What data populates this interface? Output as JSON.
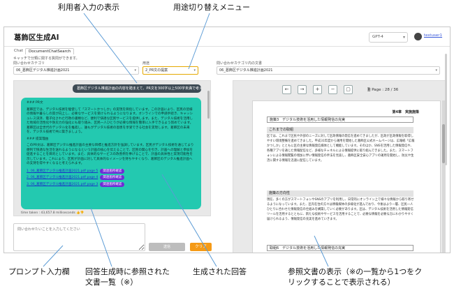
{
  "callouts": {
    "user_input_display": "利用者入力の表示",
    "usage_switch_menu": "用途切り替えメニュー",
    "prompt_input": "プロンプト入力欄",
    "references_list_line1": "回答生成時に参照された",
    "references_list_line2": "文書一覧（※）",
    "generated_answer": "生成された回答",
    "ref_doc_display_line1": "参照文書の表示（※の一覧から1つをク",
    "ref_doc_display_line2": "リックすることで表示される）"
  },
  "header": {
    "title": "葛飾区生成AI",
    "model": "GPT-4",
    "username": "testuser1"
  },
  "tabs": [
    {
      "label": "Chat",
      "active": false
    },
    {
      "label": "DocumentChatSearch",
      "active": true
    }
  ],
  "filters": {
    "hint": "キャッチで分類に関する質問ができます。",
    "category_label": "問い合わせカテゴリ",
    "category_value": "06_葛飾区デジタル推進計画2021",
    "purpose_label": "用途",
    "purpose_value": "2_PR文の提案",
    "target_doc_label": "問い合わせカテゴリ内の文書",
    "target_doc_value": "06_葛飾区デジタル推進計画2021"
  },
  "chat": {
    "user_message": "葛飾区デジタル推進計画の内容を踏まえて、PR文を300字以上500字未満で考えてください。",
    "answer_heading1": "### PR文",
    "answer_para1": "葛飾区では、デジタル技術を駆使して「スマートかつしか」の実現を目指しています。この計画により、区民の皆様の情報や暮らしの質が向上し、必要なサービスを受けられるようになります。オンラインでの申請手続き、キャッシュレス決済、電子化された行政の書類など、便利で快適な区民サービスを提供します。また、デジタル技術を活用した地域の活性化や防災力の強化にも取り組み、区民一人ひとりが必要な情報を簡単に入手できるよう努めています。葛飾区は全世代のデジタル化を推進し、誰もがデジタル技術の恩恵を享受できる社会を実現します。葛飾区の未来を、デジタル技術で共に築きましょう。",
    "answer_heading2": "### 提案理由",
    "answer_para2": "このPR文は、葛飾区デジタル推進計画の主要な目標と推進方針を強調しています。区民がデジタル技術を通じてより便利で快適な生活を送れるようになるという計画の核心を伝えることで、区民の関心を引き、計画への理解と参加を促進することを目的としています。また、具体的なサービスの改善例を挙げることで、計画の具体性と実現可能性を示しています。これにより、区民が計画に対して具体的なイメージを持ちやすくなり、葛飾区のデジタル推進計画への支持を得やすくなると考えられます。",
    "references": [
      {
        "name": "1. 06_葛飾区デジタル推進計画2021.pdf page 5",
        "button": "関連箇所確認"
      },
      {
        "name": "2. 06_葛飾区デジタル推進計画2021.pdf page 4",
        "button": "関連箇所確認"
      },
      {
        "name": "3. 06_葛飾区デジタル推進計画2021.pdf page 3",
        "button": "関連箇所確認"
      }
    ],
    "time_taken": "time taken : 43,657.8 milliseconds"
  },
  "prompt": {
    "placeholder": "問い合わせたいことを入力してください"
  },
  "buttons": {
    "send": "送信",
    "clear": "クリア"
  },
  "viewer": {
    "page_indicator": "Page : 28 / 36",
    "chapter": "第4章　実施施策",
    "section1_title": "施策3　デジタル技術を活用した情報発信の充実",
    "sub1_title": "これまでの取組",
    "sub1_text": "区では、これまで区民や外部のニーズに対して区政情報の発信を進めてきましたが、区政が区政情報を取得しやすい環境整備を進めてきました。平成31年度から運用を開始した葛飾区公式ホームページは、広報紙「広報かつしか」とともに区の主要な情報発信媒体として機能しています。そのほか、SNSを活用した情報発信や、各種アプリを通じた情報配信など、多様なチャネルによる情報提供に取り組んできました。また、スマートフォンによる情報閲覧の増加に伴い情報発信の手法を見直し、葛飾区安全安心アプリの運用を開始し、防災や生活に関する情報を迅速に配信しています。",
    "sub2_title": "施策の方向性",
    "sub2_text": "現在、多くの方がスマートフォンやSNSのアプリを利用し、日常的にオンライン上で様々な情報から取り寄せるようになっています。また、区内在住の方々は情報媒体の多様化が進んでおり、今後はより一層、区民一人ひとりに合わせた情報発信の仕組みを構築していく必要があります。区は、デジタル技術を活用した情報発信ツールを活用するとともに、新たな技術やサービスを活用することで、必要な情報を必要な方にわかりやすく届けられるよう、情報発信の充実を進めていきます。",
    "section2_title": "取組6　デジタル技術を活用した情報発信の充実"
  }
}
